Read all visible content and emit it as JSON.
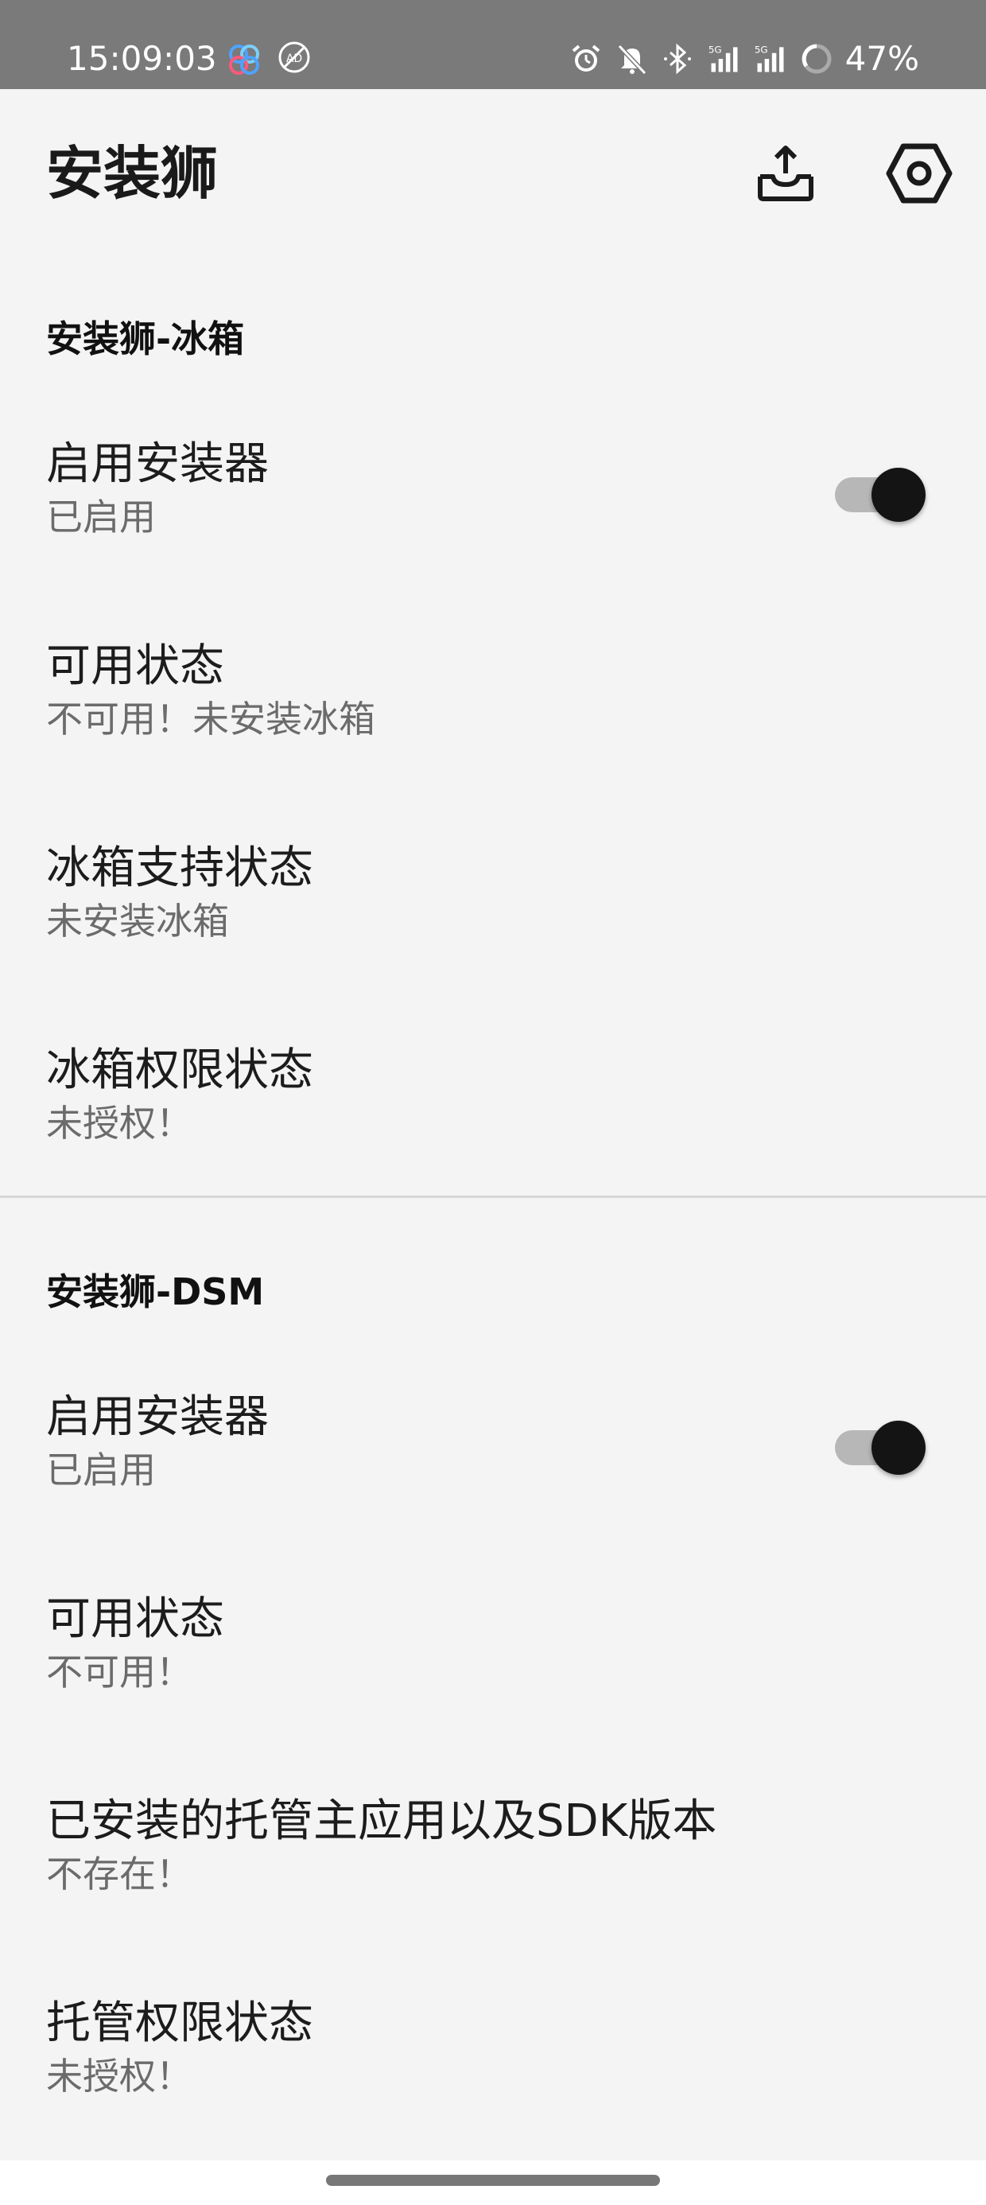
{
  "status_bar": {
    "time": "15:09:03",
    "battery": "47%",
    "network": "5G",
    "icons": [
      "app-notification-icon",
      "no-ads-icon",
      "alarm-icon",
      "bell-muted-icon",
      "bluetooth-icon",
      "signal-5g-icon",
      "signal-5g-icon",
      "battery-ring-icon"
    ]
  },
  "app_bar": {
    "title": "安装狮",
    "actions": [
      "share-icon",
      "settings-icon"
    ]
  },
  "sections": {
    "freezer": {
      "title": "安装狮-冰箱",
      "items": [
        {
          "title": "启用安装器",
          "subtitle": "已启用",
          "toggle": true
        },
        {
          "title": "可用状态",
          "subtitle": "不可用！未安装冰箱"
        },
        {
          "title": "冰箱支持状态",
          "subtitle": "未安装冰箱"
        },
        {
          "title": "冰箱权限状态",
          "subtitle": "未授权！"
        }
      ]
    },
    "dsm": {
      "title": "安装狮-DSM",
      "items": [
        {
          "title": "启用安装器",
          "subtitle": "已启用",
          "toggle": true
        },
        {
          "title": "可用状态",
          "subtitle": "不可用！"
        },
        {
          "title": "已安装的托管主应用以及SDK版本",
          "subtitle": "不存在！"
        },
        {
          "title": "托管权限状态",
          "subtitle": "未授权！"
        }
      ]
    }
  },
  "colors": {
    "status_bar_bg": "#7a7a7a",
    "background": "#f4f4f4",
    "switch_thumb": "#141414",
    "switch_track": "#b7b7b7"
  }
}
